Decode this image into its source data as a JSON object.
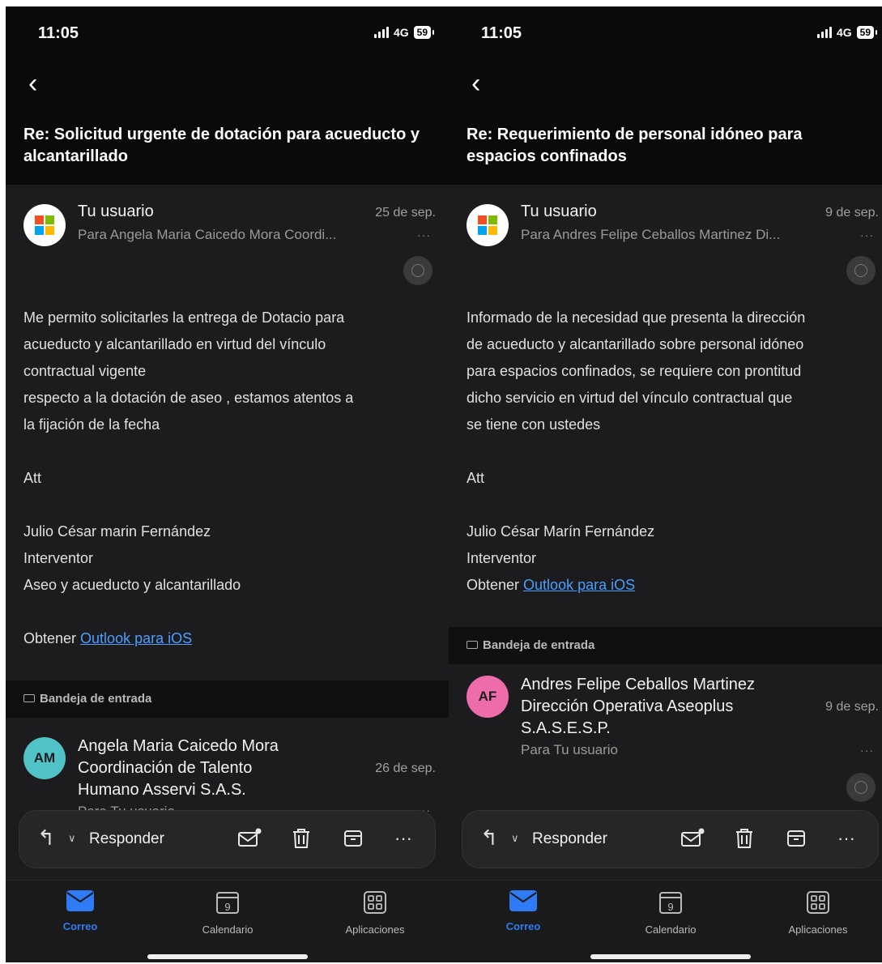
{
  "status": {
    "time": "11:05",
    "network": "4G",
    "battery": "59"
  },
  "left": {
    "subject": "Re: Solicitud urgente de dotación para acueducto y alcantarillado",
    "message": {
      "sender": "Tu usuario",
      "date": "25 de sep.",
      "recipient": "Para Angela Maria Caicedo Mora Coordi...",
      "body": [
        "Me permito solicitarles la entrega de Dotacio para",
        "acueducto y alcantarillado en virtud del vínculo",
        "contractual vigente",
        "respecto a la dotación de aseo , estamos atentos a",
        "la fijación de la fecha",
        "",
        "Att",
        "",
        "Julio César marin Fernández",
        "Interventor",
        "Aseo y acueducto y alcantarillado",
        ""
      ],
      "footer_prefix": "Obtener ",
      "footer_link": "Outlook para iOS"
    },
    "folder": "Bandeja de entrada",
    "next_message": {
      "initials": "AM",
      "avatar_color": "#4fc3c8",
      "sender_lines": [
        "Angela Maria Caicedo Mora",
        "Coordinación de Talento",
        "Humano Asservi S.A.S."
      ],
      "date": "26 de sep.",
      "recipient": "Para Tu usuario"
    }
  },
  "right": {
    "subject": "Re: Requerimiento de personal idóneo para espacios confinados",
    "message": {
      "sender": "Tu usuario",
      "date": "9 de sep.",
      "recipient": "Para Andres Felipe Ceballos Martinez Di...",
      "body": [
        "Informado de la necesidad que presenta la dirección",
        "de acueducto y alcantarillado sobre personal idóneo",
        "para espacios confinados, se requiere con prontitud",
        "dicho servicio en virtud del vínculo contractual que",
        "se tiene con ustedes",
        "",
        "Att",
        "",
        "Julio César Marín Fernández",
        "Interventor"
      ],
      "footer_prefix": "Obtener ",
      "footer_link": "Outlook para iOS"
    },
    "folder": "Bandeja de entrada",
    "next_message": {
      "initials": "AF",
      "avatar_color": "#ef6cab",
      "sender_lines": [
        "Andres Felipe Ceballos Martinez",
        "Dirección Operativa Aseoplus",
        "S.A.S.E.S.P."
      ],
      "date": "9 de sep.",
      "recipient": "Para Tu usuario"
    }
  },
  "toolbar": {
    "reply_label": "Responder"
  },
  "tabs": [
    {
      "label": "Correo",
      "icon": "mail-icon"
    },
    {
      "label": "Calendario",
      "icon": "calendar-icon",
      "day": "9"
    },
    {
      "label": "Aplicaciones",
      "icon": "apps-icon"
    }
  ],
  "colors": {
    "accent": "#2f7bf5",
    "link": "#4a9eff",
    "background": "#1c1c1e"
  }
}
